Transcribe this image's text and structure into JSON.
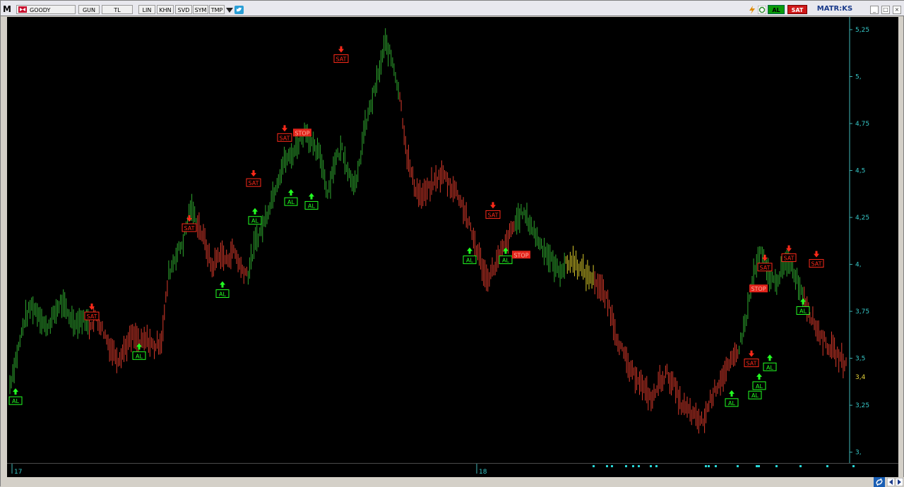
{
  "toolbar": {
    "app_logo": "M",
    "symbol": "GOODY",
    "period": "GUN",
    "currency": "TL",
    "scale_lin": "LIN",
    "khn": "KHN",
    "svd": "SVD",
    "sym": "SYM",
    "tmp": "TMP",
    "buy_label": "AL",
    "sell_label": "SAT",
    "brand": "MATR:KS"
  },
  "chart_data": {
    "type": "line",
    "y_ticks": [
      "5,25",
      "5,",
      "4,75",
      "4,5",
      "4,25",
      "4,",
      "3,75",
      "3,5",
      "3,25",
      "3,"
    ],
    "y_range": [
      2.98,
      5.28
    ],
    "last_price_label": "3,4",
    "last_price": 3.4,
    "x_labels": [
      "17",
      "18"
    ],
    "signal_labels": {
      "buy": "AL",
      "sell": "SAT",
      "stop": "STOP"
    },
    "colors": {
      "up": "#2fa82f",
      "down": "#d93a2b",
      "neutral": "#d8c82a",
      "axis_text": "#36c9c9",
      "last_price": "#e3d23a",
      "buy": "#22ff22",
      "sell": "#ff2a1a"
    },
    "closes": [
      3.36,
      3.52,
      3.7,
      3.78,
      3.74,
      3.66,
      3.72,
      3.8,
      3.74,
      3.69,
      3.71,
      3.68,
      3.72,
      3.64,
      3.55,
      3.5,
      3.56,
      3.62,
      3.58,
      3.6,
      3.56,
      3.6,
      3.95,
      4.05,
      4.12,
      4.3,
      4.22,
      4.12,
      3.98,
      4.06,
      4.02,
      4.08,
      3.98,
      3.95,
      4.12,
      4.2,
      4.32,
      4.44,
      4.55,
      4.58,
      4.65,
      4.72,
      4.62,
      4.58,
      4.38,
      4.55,
      4.62,
      4.48,
      4.42,
      4.7,
      4.85,
      5.0,
      5.18,
      5.08,
      4.9,
      4.58,
      4.42,
      4.36,
      4.4,
      4.45,
      4.48,
      4.42,
      4.38,
      4.28,
      4.16,
      4.04,
      3.92,
      3.98,
      4.06,
      4.14,
      4.22,
      4.28,
      4.22,
      4.14,
      4.08,
      4.02,
      3.96,
      4.0,
      4.02,
      3.98,
      3.94,
      3.92,
      3.86,
      3.78,
      3.62,
      3.52,
      3.42,
      3.4,
      3.32,
      3.28,
      3.38,
      3.42,
      3.35,
      3.25,
      3.22,
      3.18,
      3.16,
      3.28,
      3.36,
      3.42,
      3.48,
      3.56,
      3.72,
      3.95,
      4.06,
      3.95,
      3.9,
      3.98,
      4.02,
      3.92,
      3.82,
      3.72,
      3.64,
      3.58,
      3.54,
      3.5,
      3.46
    ],
    "trend": [
      "up",
      "up",
      "up",
      "up",
      "up",
      "up",
      "up",
      "up",
      "up",
      "up",
      "up",
      "down",
      "down",
      "down",
      "down",
      "down",
      "down",
      "down",
      "down",
      "down",
      "down",
      "down",
      "up",
      "up",
      "up",
      "up",
      "down",
      "down",
      "down",
      "down",
      "down",
      "down",
      "down",
      "up",
      "up",
      "up",
      "up",
      "up",
      "up",
      "up",
      "up",
      "up",
      "up",
      "up",
      "up",
      "up",
      "up",
      "up",
      "up",
      "up",
      "up",
      "up",
      "up",
      "up",
      "down",
      "down",
      "down",
      "down",
      "down",
      "down",
      "down",
      "down",
      "down",
      "down",
      "down",
      "down",
      "down",
      "down",
      "down",
      "down",
      "up",
      "up",
      "up",
      "up",
      "up",
      "up",
      "up",
      "neutral",
      "neutral",
      "neutral",
      "neutral",
      "down",
      "down",
      "down",
      "down",
      "down",
      "down",
      "down",
      "down",
      "down",
      "down",
      "down",
      "down",
      "down",
      "down",
      "down",
      "down",
      "down",
      "down",
      "down",
      "down",
      "up",
      "up",
      "up",
      "up",
      "up",
      "up",
      "up",
      "up",
      "up",
      "down",
      "down",
      "down",
      "down",
      "down",
      "down",
      "down"
    ],
    "signals": [
      {
        "type": "buy",
        "value": 3.28
      },
      {
        "type": "sell",
        "value": 3.72
      },
      {
        "type": "buy",
        "value": 3.52
      },
      {
        "type": "sell",
        "value": 4.19
      },
      {
        "type": "buy",
        "value": 3.85
      },
      {
        "type": "buy",
        "value": 4.24
      },
      {
        "type": "sell",
        "value": 4.43
      },
      {
        "type": "sell",
        "value": 4.67
      },
      {
        "type": "buy",
        "value": 4.34
      },
      {
        "type": "stop",
        "value": 4.7
      },
      {
        "type": "buy",
        "value": 4.32
      },
      {
        "type": "sell",
        "value": 5.09
      },
      {
        "type": "buy",
        "value": 4.03
      },
      {
        "type": "sell",
        "value": 4.26
      },
      {
        "type": "buy",
        "value": 4.03
      },
      {
        "type": "stop",
        "value": 4.05
      },
      {
        "type": "buy",
        "value": 3.27
      },
      {
        "type": "sell",
        "value": 3.47
      },
      {
        "type": "stop",
        "value": 3.87
      },
      {
        "type": "buy",
        "value": 3.31
      },
      {
        "type": "buy",
        "value": 3.36
      },
      {
        "type": "buy",
        "value": 3.46
      },
      {
        "type": "sell",
        "value": 3.98
      },
      {
        "type": "sell",
        "value": 4.03
      },
      {
        "type": "buy",
        "value": 3.76
      },
      {
        "type": "sell",
        "value": 4.0
      }
    ]
  }
}
